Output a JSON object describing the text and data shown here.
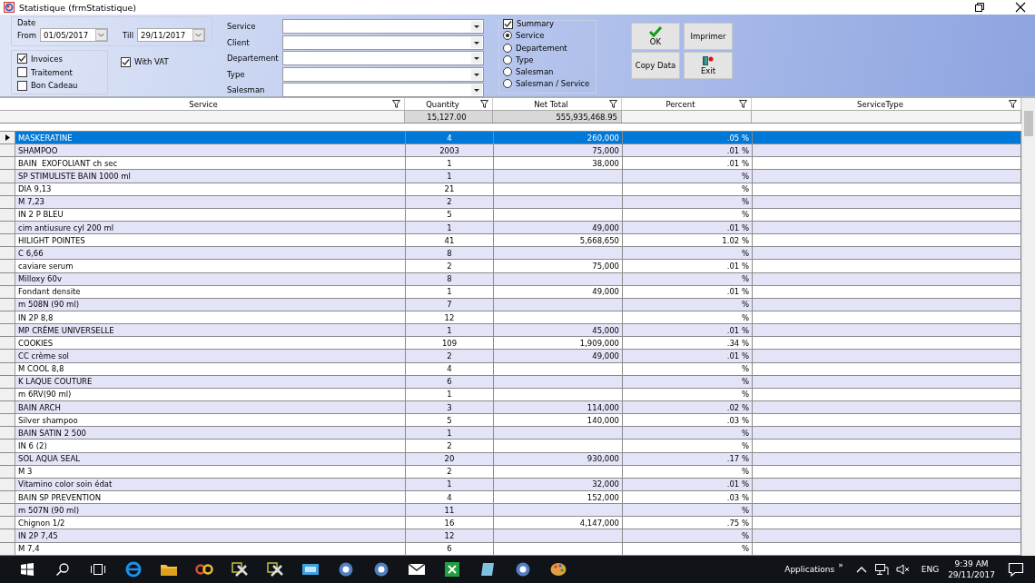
{
  "window": {
    "title": "Statistique  (frmStatistique)"
  },
  "filters": {
    "date": {
      "label": "Date",
      "from_label": "From",
      "from_value": "01/05/2017",
      "till_label": "Till",
      "till_value": "29/11/2017"
    },
    "doc_types": [
      {
        "label": "Invoices",
        "checked": true
      },
      {
        "label": "Traitement",
        "checked": false
      },
      {
        "label": "Bon Cadeau",
        "checked": false
      }
    ],
    "with_vat": {
      "label": "With VAT",
      "checked": true
    },
    "combos": [
      {
        "label": "Service"
      },
      {
        "label": "Client"
      },
      {
        "label": "Departement"
      },
      {
        "label": "Type"
      },
      {
        "label": "Salesman"
      }
    ]
  },
  "summary": {
    "label": "Summary",
    "checked": true,
    "options": [
      {
        "label": "Service",
        "selected": true
      },
      {
        "label": "Departement",
        "selected": false
      },
      {
        "label": "Type",
        "selected": false
      },
      {
        "label": "Salesman",
        "selected": false
      },
      {
        "label": "Salesman / Service",
        "selected": false
      }
    ]
  },
  "buttons": [
    {
      "label": "OK",
      "kind": "ok"
    },
    {
      "label": "Imprimer",
      "kind": "plain"
    },
    {
      "label": "Copy Data",
      "kind": "plain"
    },
    {
      "label": "Exit",
      "kind": "exit"
    }
  ],
  "table": {
    "columns": [
      {
        "label": "Service"
      },
      {
        "label": "Quantity"
      },
      {
        "label": "Net Total"
      },
      {
        "label": "Percent"
      },
      {
        "label": "ServiceType"
      }
    ],
    "totals": {
      "quantity": "15,127.00",
      "net_total": "555,935,468.95"
    },
    "rows": [
      {
        "service": "MASKERATINE",
        "quantity": "4",
        "net_total": "260,000",
        "percent": ".05 %",
        "selected": true
      },
      {
        "service": "SHAMPOO",
        "quantity": "2003",
        "net_total": "75,000",
        "percent": ".01 %",
        "selected": false
      },
      {
        "service": "BAIN  EXOFOLIANT ch sec",
        "quantity": "1",
        "net_total": "38,000",
        "percent": ".01 %",
        "selected": false
      },
      {
        "service": "SP STIMULISTE BAIN 1000 ml",
        "quantity": "1",
        "percent": "%",
        "selected": false
      },
      {
        "service": "DIA 9,13",
        "quantity": "21",
        "percent": "%",
        "selected": false
      },
      {
        "service": "M 7,23",
        "quantity": "2",
        "percent": "%",
        "selected": false
      },
      {
        "service": "IN 2 P BLEU",
        "quantity": "5",
        "percent": "%",
        "selected": false
      },
      {
        "service": "cim antiusure cyl 200 ml",
        "quantity": "1",
        "net_total": "49,000",
        "percent": ".01 %",
        "selected": false
      },
      {
        "service": "HILIGHT POINTES",
        "quantity": "41",
        "net_total": "5,668,650",
        "percent": "1.02 %",
        "selected": false
      },
      {
        "service": "C 6,66",
        "quantity": "8",
        "percent": "%",
        "selected": false
      },
      {
        "service": "caviare serum",
        "quantity": "2",
        "net_total": "75,000",
        "percent": ".01 %",
        "selected": false
      },
      {
        "service": "Milloxy 60v",
        "quantity": "8",
        "percent": "%",
        "selected": false
      },
      {
        "service": "Fondant densite",
        "quantity": "1",
        "net_total": "49,000",
        "percent": ".01 %",
        "selected": false
      },
      {
        "service": "m 508N (90 ml)",
        "quantity": "7",
        "percent": "%",
        "selected": false
      },
      {
        "service": "IN 2P 8,8",
        "quantity": "12",
        "percent": "%",
        "selected": false
      },
      {
        "service": "MP CRÈME UNIVERSELLE",
        "quantity": "1",
        "net_total": "45,000",
        "percent": ".01 %",
        "selected": false
      },
      {
        "service": "COOKIES",
        "quantity": "109",
        "net_total": "1,909,000",
        "percent": ".34 %",
        "selected": false
      },
      {
        "service": "CC crème sol",
        "quantity": "2",
        "net_total": "49,000",
        "percent": ".01 %",
        "selected": false
      },
      {
        "service": "M COOL 8,8",
        "quantity": "4",
        "percent": "%",
        "selected": false
      },
      {
        "service": "K LAQUE COUTURE",
        "quantity": "6",
        "percent": "%",
        "selected": false
      },
      {
        "service": "m 6RV(90 ml)",
        "quantity": "1",
        "percent": "%",
        "selected": false
      },
      {
        "service": "BAIN ARCH",
        "quantity": "3",
        "net_total": "114,000",
        "percent": ".02 %",
        "selected": false
      },
      {
        "service": "Silver shampoo",
        "quantity": "5",
        "net_total": "140,000",
        "percent": ".03 %",
        "selected": false
      },
      {
        "service": "BAIN SATIN 2 500",
        "quantity": "1",
        "percent": "%",
        "selected": false
      },
      {
        "service": "IN 6 (2)",
        "quantity": "2",
        "percent": "%",
        "selected": false
      },
      {
        "service": "SOL AQUA SEAL",
        "quantity": "20",
        "net_total": "930,000",
        "percent": ".17 %",
        "selected": false
      },
      {
        "service": "M 3",
        "quantity": "2",
        "percent": "%",
        "selected": false
      },
      {
        "service": "Vitamino color soin édat",
        "quantity": "1",
        "net_total": "32,000",
        "percent": ".01 %",
        "selected": false
      },
      {
        "service": "BAIN SP PREVENTION",
        "quantity": "4",
        "net_total": "152,000",
        "percent": ".03 %",
        "selected": false
      },
      {
        "service": "m 507N (90 ml)",
        "quantity": "11",
        "percent": "%",
        "selected": false
      },
      {
        "service": "Chignon 1/2",
        "quantity": "16",
        "net_total": "4,147,000",
        "percent": ".75 %",
        "selected": false
      },
      {
        "service": "IN 2P 7,45",
        "quantity": "12",
        "percent": "%",
        "selected": false
      },
      {
        "service": "M 7,4",
        "quantity": "6",
        "percent": "%",
        "selected": false
      }
    ]
  },
  "taskbar": {
    "apps": [
      {
        "kind": "start"
      },
      {
        "kind": "search"
      },
      {
        "kind": "taskview"
      },
      {
        "kind": "browser"
      },
      {
        "kind": "folder"
      },
      {
        "kind": "loop"
      },
      {
        "kind": "tools"
      },
      {
        "kind": "tools"
      },
      {
        "kind": "screen"
      },
      {
        "kind": "circle"
      },
      {
        "kind": "circle"
      },
      {
        "kind": "envelope"
      },
      {
        "kind": "sheet"
      },
      {
        "kind": "tile"
      },
      {
        "kind": "circle"
      },
      {
        "kind": "palette"
      }
    ],
    "tray_label": "Applications",
    "chevron": "»",
    "language": "ENG",
    "time": "9:39 AM",
    "date": "29/11/2017"
  }
}
